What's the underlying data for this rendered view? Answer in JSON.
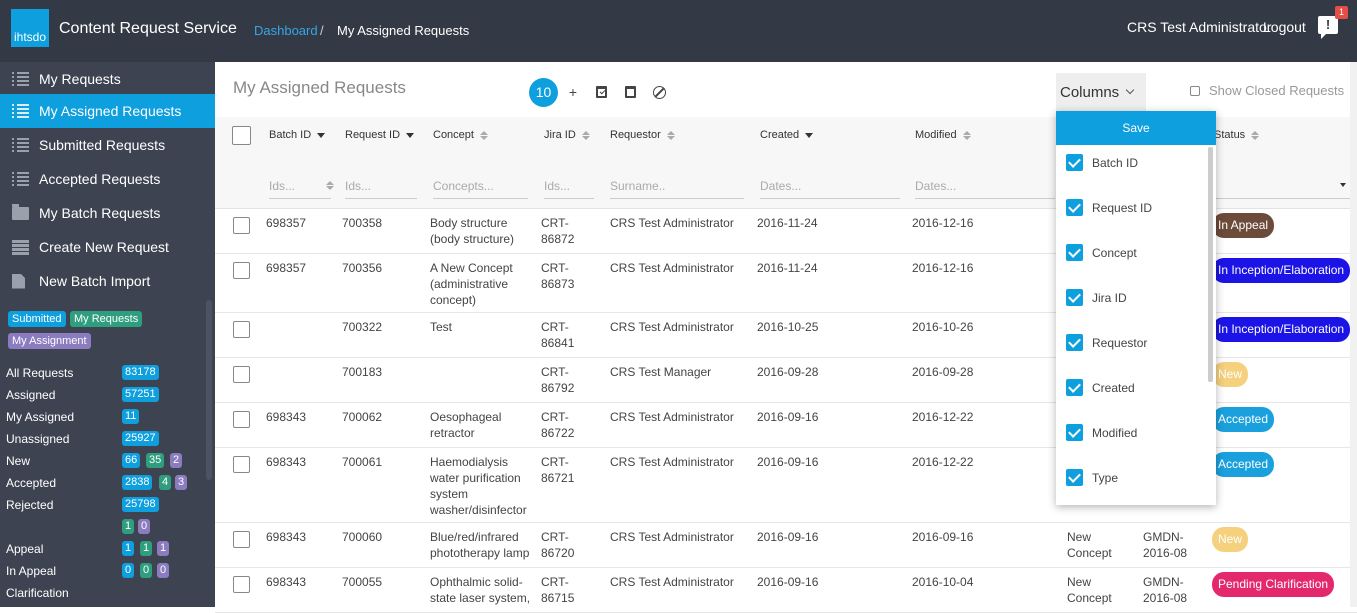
{
  "header": {
    "logo": "ihtsdo",
    "app_title": "Content Request Service",
    "breadcrumb": [
      "Dashboard",
      "/",
      "My Assigned Requests"
    ],
    "user": "CRS Test Administrator",
    "logout": "Logout",
    "notif_icon": "!",
    "notif_count": "1"
  },
  "sidebar": {
    "items": [
      {
        "label": "My Requests",
        "icon": "list-icon"
      },
      {
        "label": "My Assigned Requests",
        "icon": "list-icon",
        "active": true
      },
      {
        "label": "Submitted Requests",
        "icon": "list-icon"
      },
      {
        "label": "Accepted Requests",
        "icon": "list-icon"
      },
      {
        "label": "My Batch Requests",
        "icon": "folder-icon"
      },
      {
        "label": "Create New Request",
        "icon": "table-icon"
      },
      {
        "label": "New Batch Import",
        "icon": "file-icon"
      }
    ],
    "tags": [
      "Submitted",
      "My Requests",
      "My Assignment"
    ],
    "stats": [
      {
        "label": "All Requests",
        "counts": [
          "83178"
        ]
      },
      {
        "label": "Assigned",
        "counts": [
          "57251"
        ]
      },
      {
        "label": "My Assigned",
        "counts": [
          "11"
        ]
      },
      {
        "label": "Unassigned",
        "counts": [
          "25927"
        ]
      },
      {
        "label": "New",
        "counts": [
          "66",
          "35",
          "2"
        ]
      },
      {
        "label": "Accepted",
        "counts": [
          "2838",
          "4",
          "3"
        ]
      },
      {
        "label": "Rejected",
        "counts": [
          "25798"
        ]
      },
      {
        "label": "",
        "counts": [
          "1",
          "0"
        ]
      },
      {
        "label": "Appeal",
        "counts": [
          "1",
          "1",
          "1"
        ]
      },
      {
        "label": "In Appeal",
        "counts": [
          "0",
          "0",
          "0"
        ]
      },
      {
        "label": "Clarification",
        "counts": []
      }
    ]
  },
  "main": {
    "title": "My Assigned Requests",
    "count": "10",
    "tools": {
      "add": "+"
    },
    "columns_label": "Columns",
    "show_closed": "Show Closed Requests",
    "headers": [
      "Batch ID",
      "Request ID",
      "Concept",
      "Jira ID",
      "Requestor",
      "Created",
      "Modified",
      "Status"
    ],
    "filters": [
      "Ids...",
      "Ids...",
      "Concepts...",
      "Ids...",
      "Surname..",
      "Dates...",
      "Dates..."
    ],
    "rows": [
      {
        "batch": "698357",
        "req": "700358",
        "concept": "Body structure (body structure)",
        "jira": "CRT-86872",
        "requestor": "CRS Test Administrator",
        "created": "2016-11-24",
        "modified": "2016-12-16",
        "type": "",
        "ext": "",
        "status": "In Appeal"
      },
      {
        "batch": "698357",
        "req": "700356",
        "concept": "A New Concept (administrative concept)",
        "jira": "CRT-86873",
        "requestor": "CRS Test Administrator",
        "created": "2016-11-24",
        "modified": "2016-12-16",
        "type": "",
        "ext": "",
        "status": "In Inception/Elaboration"
      },
      {
        "batch": "",
        "req": "700322",
        "concept": "Test",
        "jira": "CRT-86841",
        "requestor": "CRS Test Administrator",
        "created": "2016-10-25",
        "modified": "2016-10-26",
        "type": "",
        "ext": "",
        "status": "In Inception/Elaboration"
      },
      {
        "batch": "",
        "req": "700183",
        "concept": "",
        "jira": "CRT-86792",
        "requestor": "CRS Test Manager",
        "created": "2016-09-28",
        "modified": "2016-09-28",
        "type": "",
        "ext": "",
        "status": "New"
      },
      {
        "batch": "698343",
        "req": "700062",
        "concept": "Oesophageal retractor",
        "jira": "CRT-86722",
        "requestor": "CRS Test Administrator",
        "created": "2016-09-16",
        "modified": "2016-12-22",
        "type": "",
        "ext": "",
        "status": "Accepted"
      },
      {
        "batch": "698343",
        "req": "700061",
        "concept": "Haemodialysis water purification system washer/disinfector",
        "jira": "CRT-86721",
        "requestor": "CRS Test Administrator",
        "created": "2016-09-16",
        "modified": "2016-12-22",
        "type": "",
        "ext": "",
        "status": "Accepted"
      },
      {
        "batch": "698343",
        "req": "700060",
        "concept": "Blue/red/infrared phototherapy lamp",
        "jira": "CRT-86720",
        "requestor": "CRS Test Administrator",
        "created": "2016-09-16",
        "modified": "2016-09-16",
        "type": "New Concept",
        "ext": "GMDN-2016-08",
        "status": "New"
      },
      {
        "batch": "698343",
        "req": "700055",
        "concept": "Ophthalmic solid-state laser system,",
        "jira": "CRT-86715",
        "requestor": "CRS Test Administrator",
        "created": "2016-09-16",
        "modified": "2016-10-04",
        "type": "New Concept",
        "ext": "GMDN-2016-08",
        "status": "Pending Clarification"
      }
    ]
  },
  "columns_menu": {
    "save": "Save",
    "options": [
      "Batch ID",
      "Request ID",
      "Concept",
      "Jira ID",
      "Requestor",
      "Created",
      "Modified",
      "Type"
    ]
  },
  "colors": {
    "topbar": "#343a45",
    "sidebar": "#3d4350",
    "accent": "#0e9fde",
    "in_appeal": "#6d4b3b",
    "inception": "#1c14e6",
    "new": "#f5d07d",
    "accepted": "#1aa0dc",
    "pending": "#e4286c"
  }
}
